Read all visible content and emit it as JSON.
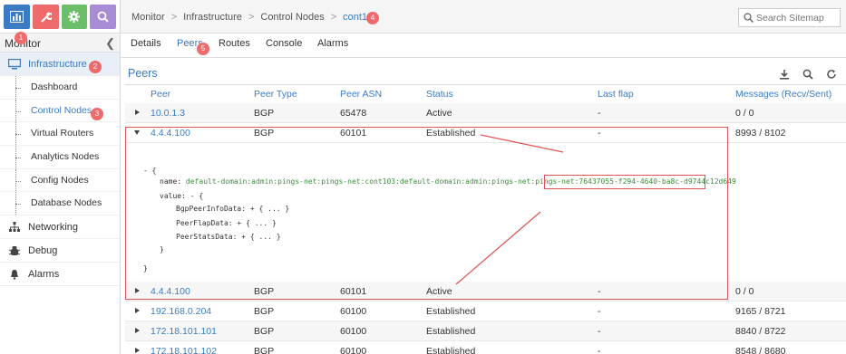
{
  "sidebar": {
    "title": "Monitor",
    "top_tabs": [
      {
        "name": "monitor",
        "icon": "bar-chart-icon",
        "color": "#3b7bc4"
      },
      {
        "name": "configure",
        "icon": "wrench-icon",
        "color": "#ef6b6b"
      },
      {
        "name": "settings",
        "icon": "gear-icon",
        "color": "#6bbf6b"
      },
      {
        "name": "query",
        "icon": "search-icon",
        "color": "#a98cd6"
      }
    ],
    "infrastructure": {
      "label": "Infrastructure",
      "icon": "monitor-icon"
    },
    "items": [
      {
        "label": "Dashboard"
      },
      {
        "label": "Control Nodes"
      },
      {
        "label": "Virtual Routers"
      },
      {
        "label": "Analytics Nodes"
      },
      {
        "label": "Config Nodes"
      },
      {
        "label": "Database Nodes"
      }
    ],
    "networking": {
      "label": "Networking",
      "icon": "network-icon"
    },
    "debug": {
      "label": "Debug",
      "icon": "bug-icon"
    },
    "alarms": {
      "label": "Alarms",
      "icon": "bell-icon"
    }
  },
  "breadcrumb": {
    "items": [
      "Monitor",
      "Infrastructure",
      "Control Nodes",
      "cont103"
    ],
    "separator": ">"
  },
  "search": {
    "placeholder": "Search Sitemap"
  },
  "subtabs": [
    "Details",
    "Peers",
    "Routes",
    "Console",
    "Alarms"
  ],
  "panel": {
    "title": "Peers"
  },
  "table": {
    "headers": [
      "Peer",
      "Peer Type",
      "Peer ASN",
      "Status",
      "Last flap",
      "Messages (Recv/Sent)"
    ],
    "rows": [
      {
        "peer": "10.0.1.3",
        "type": "BGP",
        "asn": "65478",
        "status": "Active",
        "last_flap": "-",
        "messages": "0 / 0"
      },
      {
        "peer": "4.4.4.100",
        "type": "BGP",
        "asn": "60101",
        "status": "Established",
        "last_flap": "-",
        "messages": "8993 / 8102"
      },
      {
        "peer": "4.4.4.100",
        "type": "BGP",
        "asn": "60101",
        "status": "Active",
        "last_flap": "-",
        "messages": "0 / 0"
      },
      {
        "peer": "192.168.0.204",
        "type": "BGP",
        "asn": "60100",
        "status": "Established",
        "last_flap": "-",
        "messages": "9165 / 8721"
      },
      {
        "peer": "172.18.101.101",
        "type": "BGP",
        "asn": "60100",
        "status": "Established",
        "last_flap": "-",
        "messages": "8840 / 8722"
      },
      {
        "peer": "172.18.101.102",
        "type": "BGP",
        "asn": "60100",
        "status": "Established",
        "last_flap": "-",
        "messages": "8548 / 8680"
      }
    ]
  },
  "json_detail": {
    "open": "- {",
    "name_key": "name:",
    "name_value_prefix": "default-domain:admin:pings-net:pings-net:cont103:default-domain:admin:pings-net:pings-net:",
    "name_value_uuid": "76437055-f294-4640-ba8c-d9744c12d649",
    "value_key": "value: - {",
    "fields": [
      "BgpPeerInfoData: + { ... }",
      "PeerFlapData: + { ... }",
      "PeerStatsData: + { ... }"
    ],
    "inner_close": "}",
    "outer_close": "}"
  },
  "annotations": [
    "1",
    "2",
    "3",
    "4",
    "5"
  ],
  "colors": {
    "accent": "#3b7bc4",
    "highlight": "#e05656",
    "badge": "#ef6b6b",
    "json_value": "#3a8f3a"
  }
}
